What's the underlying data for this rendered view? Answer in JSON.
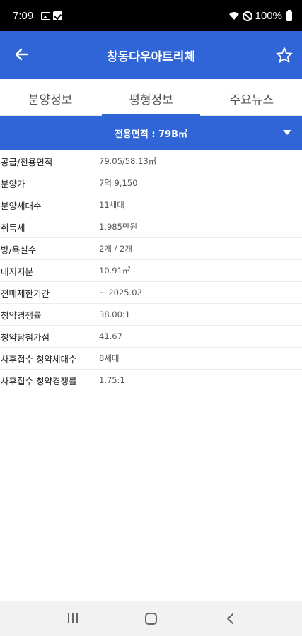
{
  "status_bar": {
    "time": "7:09",
    "battery": "100%"
  },
  "app_bar": {
    "title": "창동다우아트리체",
    "back_icon": "arrow-left-icon",
    "favorite_icon": "star-outline-icon"
  },
  "tabs": [
    {
      "label": "분양정보",
      "active": false
    },
    {
      "label": "평형정보",
      "active": true
    },
    {
      "label": "주요뉴스",
      "active": false
    }
  ],
  "area_selector": {
    "label": "전용면적 : 79B㎡",
    "icon": "dropdown-arrow-icon"
  },
  "info_rows": [
    {
      "label": "공급/전용면적",
      "value": "79.05/58.13㎡"
    },
    {
      "label": "분양가",
      "value": "7억 9,150"
    },
    {
      "label": "분양세대수",
      "value": "11세대"
    },
    {
      "label": "취득세",
      "value": "1,985만원"
    },
    {
      "label": "방/욕실수",
      "value": "2개 / 2개"
    },
    {
      "label": "대지지분",
      "value": "10.91㎡"
    },
    {
      "label": "전매제한기간",
      "value": "~ 2025.02"
    },
    {
      "label": "청약경쟁률",
      "value": "38.00:1"
    },
    {
      "label": "청약당첨가점",
      "value": "41.67"
    },
    {
      "label": "사후접수 청약세대수",
      "value": "8세대"
    },
    {
      "label": "사후접수 청약경쟁률",
      "value": "1.75:1"
    }
  ],
  "colors": {
    "primary": "#2f65d6",
    "status_bar": "#000000",
    "nav_bar": "#f2f2f2"
  }
}
